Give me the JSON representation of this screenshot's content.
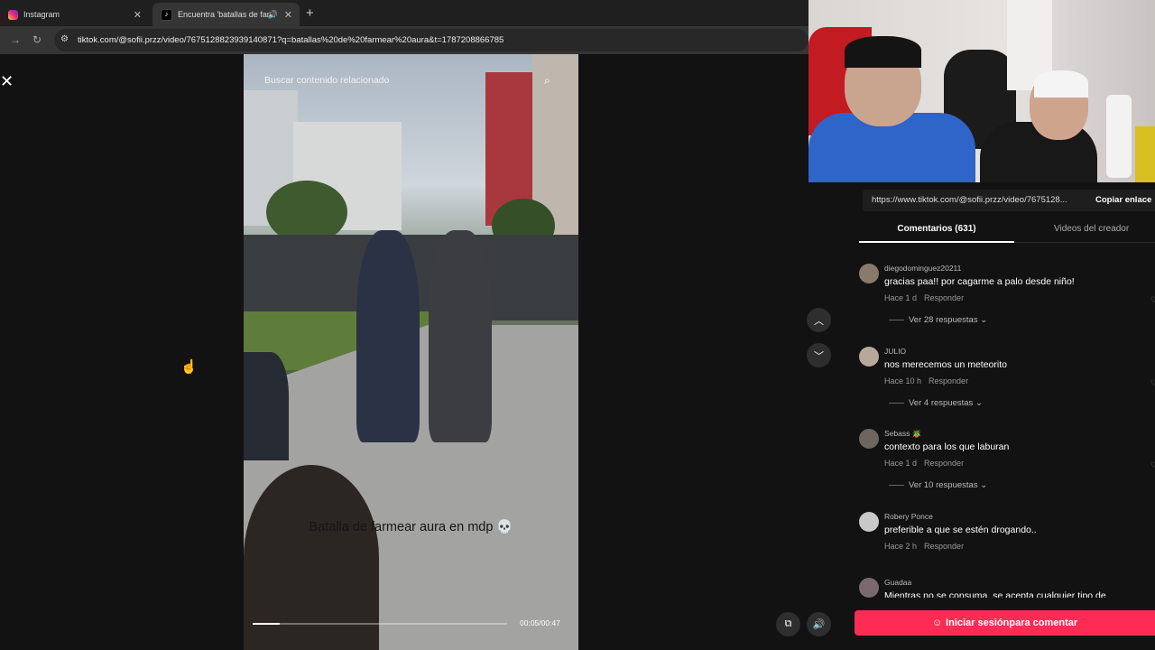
{
  "browser": {
    "tabs": [
      {
        "title": "Instagram",
        "active": false
      },
      {
        "title": "Encuentra 'batallas de farm",
        "active": true
      }
    ],
    "address_url": "tiktok.com/@sofii.przz/video/7675128823939140871?q=batallas%20de%20farmear%20aura&t=1787208866785"
  },
  "video": {
    "search_placeholder": "Buscar contenido relacionado",
    "caption": "Batalla de farmear aura en mdp 💀",
    "time": "00:05/00:47",
    "progress": 0.106
  },
  "panel": {
    "share_link": "https://www.tiktok.com/@sofii.przz/video/7675128...",
    "copy_label": "Copiar enlace",
    "tabs": [
      "Comentarios (631)",
      "Videos del creador"
    ],
    "comments": [
      {
        "user": "diegodominguez20211",
        "text": "gracias paa!! por cagarme a palo desde niño!",
        "time": "Hace 1 d",
        "reply": "Responder",
        "replies": "Ver 28 respuestas"
      },
      {
        "user": "JULIO",
        "text": "nos merecemos un meteorito",
        "time": "Hace 10 h",
        "reply": "Responder",
        "replies": "Ver 4 respuestas"
      },
      {
        "user": "Sebass 🪴",
        "text": "contexto para los que laburan",
        "time": "Hace 1 d",
        "reply": "Responder",
        "replies": "Ver 10 respuestas"
      },
      {
        "user": "Robery Ponce",
        "text": "preferible a que se estén drogando..",
        "time": "Hace 2 h",
        "reply": "Responder",
        "replies": ""
      },
      {
        "user": "Guadaa",
        "text": "Mientras no se consuma, se acepta cualquier tipo de",
        "time": "",
        "reply": "",
        "replies": ""
      }
    ],
    "login_button": "Iniciar sesiónpara comentar"
  },
  "colors": {
    "accent": "#fe2c55",
    "background": "#121212"
  }
}
